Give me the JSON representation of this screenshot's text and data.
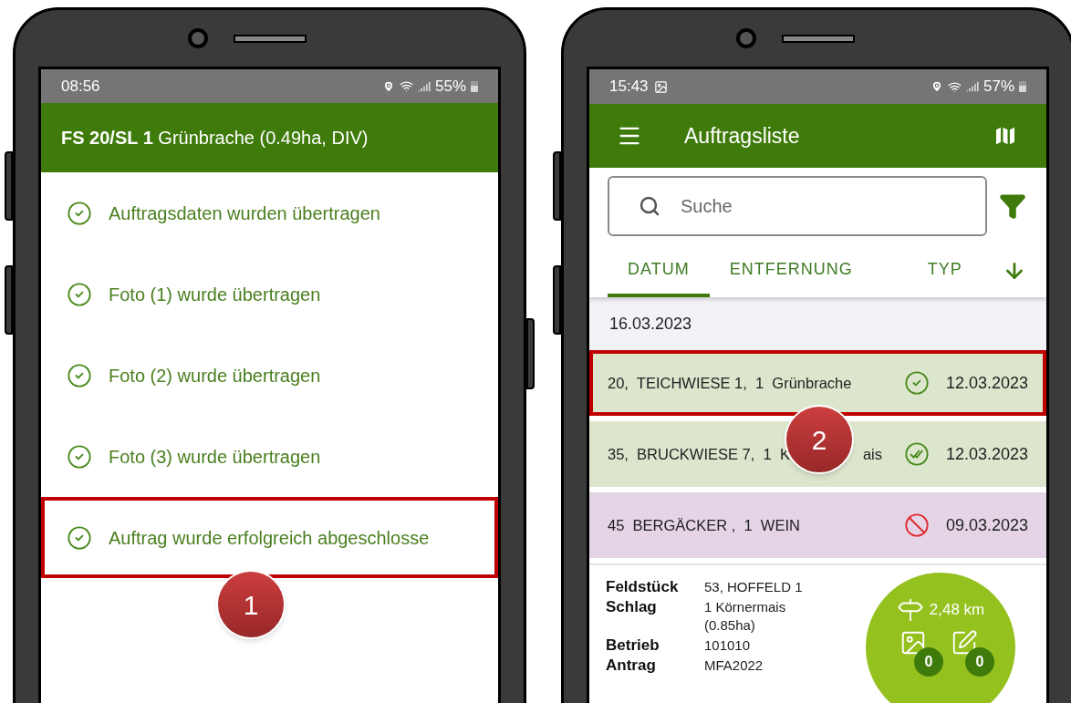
{
  "phones": [
    {
      "kind": "confirmation",
      "status_bar": {
        "time": "08:56",
        "battery": "55%"
      },
      "header": {
        "title": "**FS 20/SL 1** Grünbrache (0.49ha, DIV)"
      },
      "messages": [
        {
          "text": "Auftragsdaten wurden übertragen",
          "highlighted": false
        },
        {
          "text": "Foto (1) wurde übertragen",
          "highlighted": false
        },
        {
          "text": "Foto (2) wurde übertragen",
          "highlighted": false
        },
        {
          "text": "Foto (3) wurde übertragen",
          "highlighted": false
        },
        {
          "text": "Auftrag wurde erfolgreich abgeschlosse",
          "highlighted": true,
          "callout": "1"
        }
      ]
    },
    {
      "kind": "list",
      "status_bar": {
        "time": "15:43",
        "battery": "57%"
      },
      "header": {
        "title": "Auftragsliste"
      },
      "search": {
        "placeholder": "Suche"
      },
      "tabs": [
        {
          "label": "DATUM",
          "selected": true
        },
        {
          "label": "ENTFERNUNG",
          "selected": false
        },
        {
          "label": "TYP",
          "selected": false
        }
      ],
      "date_header": "16.03.2023",
      "rows": [
        {
          "text": "20,  TEICHWIESE 1,  1  Grünbrache",
          "kind": "done",
          "date": "12.03.2023",
          "color": "#dce6cd",
          "highlighted": true
        },
        {
          "text": "35,  BRUCKWIESE 7,  1  K",
          "callout": "2",
          "text_after": "ais",
          "kind": "synced",
          "date": "12.03.2023",
          "color": "#dce6cd",
          "highlighted": false
        },
        {
          "text": "45  BERGÄCKER ,  1  WEIN",
          "kind": "blocked",
          "date": "09.03.2023",
          "color": "#e4d4e6",
          "highlighted": false
        }
      ],
      "details": [
        {
          "label": "Feldstück",
          "value": "53,  HOFFELD 1"
        },
        {
          "label": "Schlag",
          "value": "1  Körnermais (0.85ha)"
        },
        {
          "label": "Betrieb",
          "value": "101010"
        },
        {
          "label": "Antrag",
          "value": "MFA2022"
        }
      ],
      "summary": {
        "distance": "2,48 km",
        "photos": "0",
        "notes": "0"
      }
    }
  ]
}
